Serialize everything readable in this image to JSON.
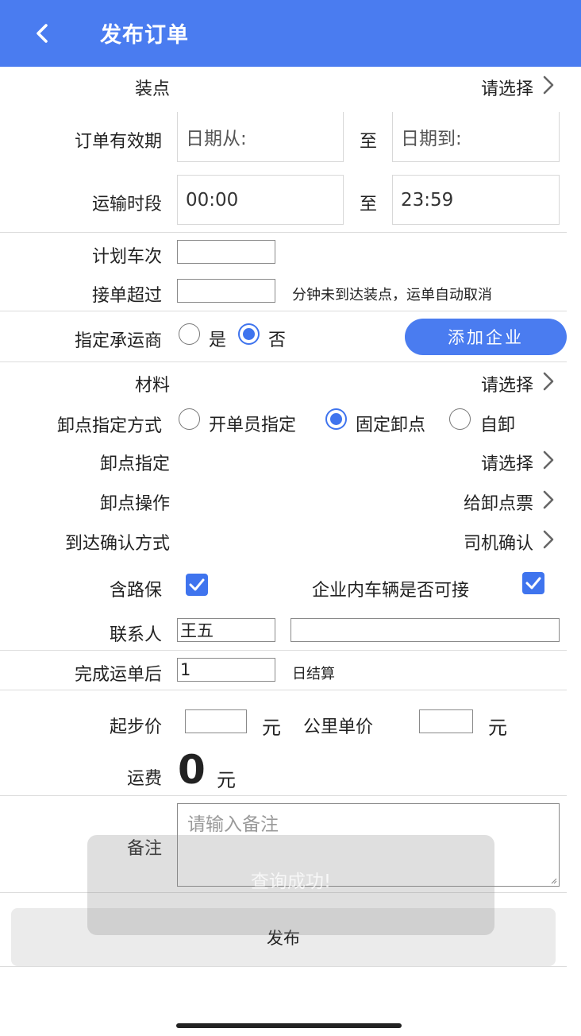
{
  "header": {
    "title": "发布订单"
  },
  "load_point": {
    "label": "装点",
    "value": "请选择"
  },
  "validity": {
    "label": "订单有效期",
    "from_placeholder": "日期从:",
    "to_word": "至",
    "to_placeholder": "日期到:"
  },
  "transport_period": {
    "label": "运输时段",
    "from": "00:00",
    "to_word": "至",
    "to": "23:59"
  },
  "planned_trips": {
    "label": "计划车次",
    "value": ""
  },
  "accept_timeout": {
    "label": "接单超过",
    "value": "",
    "suffix": "分钟未到达装点，运单自动取消"
  },
  "carrier": {
    "label": "指定承运商",
    "yes": "是",
    "no": "否",
    "selected": "否",
    "add_button": "添加企业"
  },
  "material": {
    "label": "材料",
    "value": "请选择"
  },
  "unload_method": {
    "label": "卸点指定方式",
    "options": [
      "开单员指定",
      "固定卸点",
      "自卸"
    ],
    "selected": "固定卸点"
  },
  "unload_point": {
    "label": "卸点指定",
    "value": "请选择"
  },
  "unload_operation": {
    "label": "卸点操作",
    "value": "给卸点票"
  },
  "arrival_confirm": {
    "label": "到达确认方式",
    "value": "司机确认"
  },
  "road_insurance": {
    "label": "含路保",
    "checked": true
  },
  "internal_vehicle": {
    "label": "企业内车辆是否可接",
    "checked": true
  },
  "contact": {
    "label": "联系人",
    "name": "王五",
    "phone": ""
  },
  "settlement": {
    "label": "完成运单后",
    "value": "1",
    "suffix": "日结算"
  },
  "pricing": {
    "start_label": "起步价",
    "start_value": "",
    "unit": "元",
    "km_label": "公里单价",
    "km_value": "",
    "km_unit": "元"
  },
  "freight": {
    "label": "运费",
    "value": "0",
    "unit": "元"
  },
  "remarks": {
    "label": "备注",
    "placeholder": "请输入备注"
  },
  "publish_button": "发布",
  "toast": "查询成功!",
  "colors": {
    "accent": "#4a7cf0",
    "radio": "#3f74ee"
  }
}
